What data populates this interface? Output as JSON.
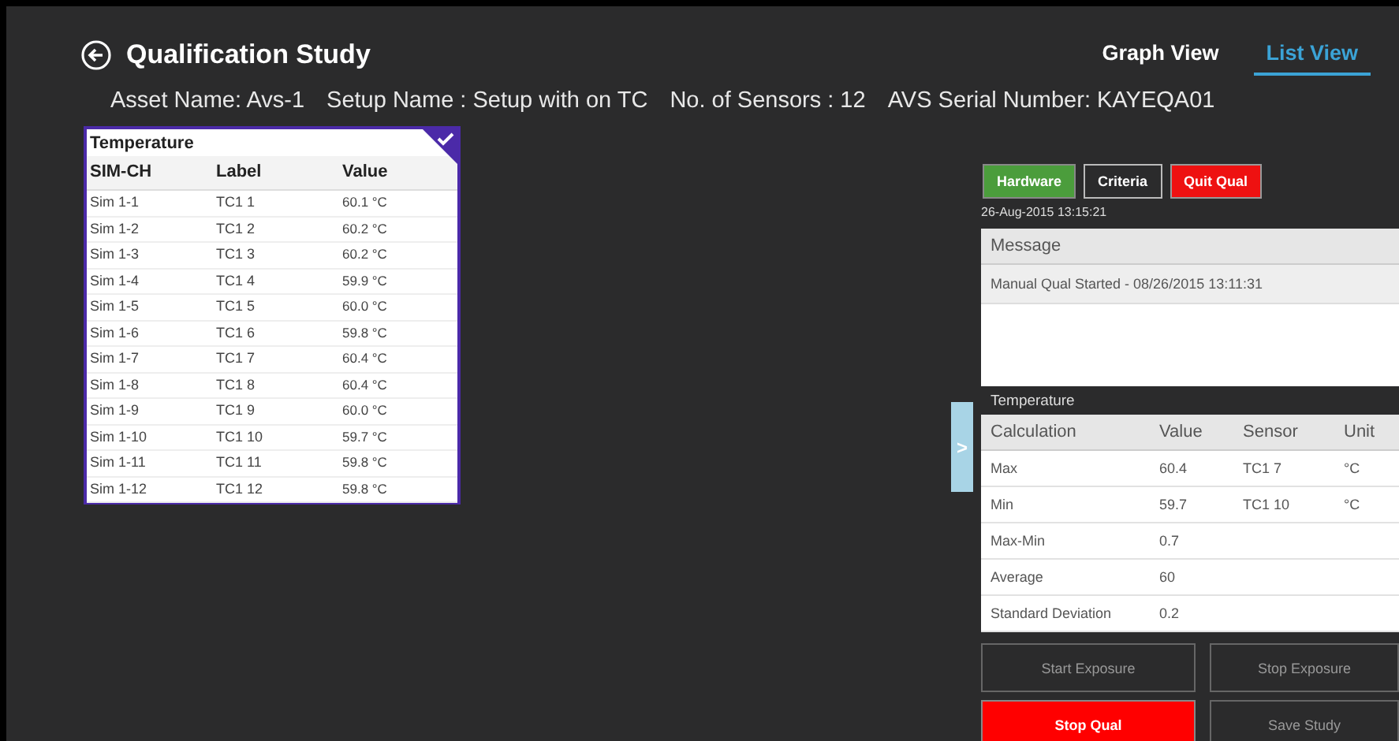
{
  "header": {
    "title": "Qualification Study",
    "tabs": [
      {
        "label": "Graph View",
        "selected": false
      },
      {
        "label": "List View",
        "selected": true
      }
    ]
  },
  "info": [
    "Asset Name: Avs-1",
    "Setup Name : Setup with on TC",
    "No. of Sensors : 12",
    "AVS Serial Number:  KAYEQA01"
  ],
  "sensor_card": {
    "title": "Temperature",
    "checked": true,
    "columns": [
      "SIM-CH",
      "Label",
      "Value"
    ],
    "rows": [
      [
        "Sim 1-1",
        "TC1 1",
        "60.1 °C"
      ],
      [
        "Sim 1-2",
        "TC1 2",
        "60.2 °C"
      ],
      [
        "Sim 1-3",
        "TC1 3",
        "60.2 °C"
      ],
      [
        "Sim 1-4",
        "TC1 4",
        "59.9 °C"
      ],
      [
        "Sim 1-5",
        "TC1 5",
        "60.0 °C"
      ],
      [
        "Sim 1-6",
        "TC1 6",
        "59.8 °C"
      ],
      [
        "Sim 1-7",
        "TC1 7",
        "60.4 °C"
      ],
      [
        "Sim 1-8",
        "TC1 8",
        "60.4 °C"
      ],
      [
        "Sim 1-9",
        "TC1 9",
        "60.0 °C"
      ],
      [
        "Sim 1-10",
        "TC1 10",
        "59.7 °C"
      ],
      [
        "Sim 1-11",
        "TC1 11",
        "59.8 °C"
      ],
      [
        "Sim 1-12",
        "TC1 12",
        "59.8 °C"
      ]
    ]
  },
  "top_buttons": [
    {
      "label": "Hardware",
      "kind": "green"
    },
    {
      "label": "Criteria",
      "kind": "outline"
    },
    {
      "label": "Quit Qual",
      "kind": "red"
    }
  ],
  "timestamp": "26-Aug-2015 13:15:21",
  "messages": {
    "header": "Message",
    "rows": [
      "Manual Qual Started - 08/26/2015 13:11:31"
    ]
  },
  "side_tab": ">",
  "calculations": {
    "title": "Temperature",
    "columns": [
      "Calculation",
      "Value",
      "Sensor",
      "Unit"
    ],
    "rows": [
      [
        "Max",
        "60.4",
        "TC1 7",
        "°C"
      ],
      [
        "Min",
        "59.7",
        "TC1 10",
        "°C"
      ],
      [
        "Max-Min",
        "0.7",
        "",
        ""
      ],
      [
        "Average",
        "60",
        "",
        ""
      ],
      [
        "Standard Deviation",
        "0.2",
        "",
        ""
      ]
    ]
  },
  "bottom_buttons": [
    {
      "label": "Start Exposure",
      "kind": "dark",
      "disabled": true
    },
    {
      "label": "Stop Exposure",
      "kind": "dark",
      "disabled": true
    },
    {
      "label": "Stop Qual",
      "kind": "red",
      "disabled": false
    },
    {
      "label": "Save Study",
      "kind": "dark",
      "disabled": true
    }
  ]
}
